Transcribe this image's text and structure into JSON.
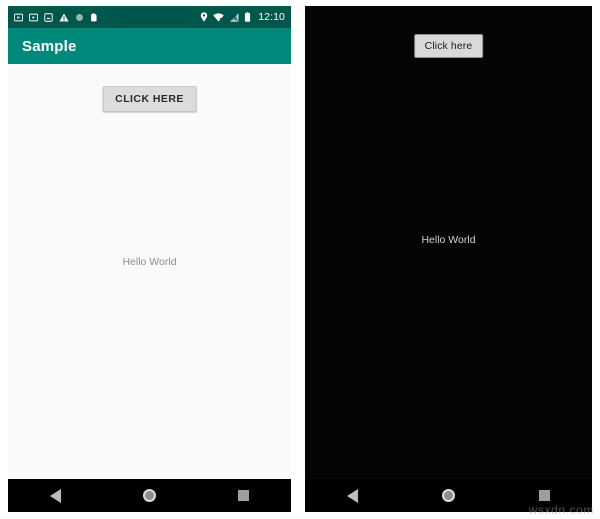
{
  "left_phone": {
    "theme_label": "light",
    "status_bar": {
      "background": "#00564a",
      "clock": "12:10",
      "left_icons": [
        {
          "name": "video-notification-icon",
          "glyph": "video"
        },
        {
          "name": "video-notification-icon-2",
          "glyph": "video"
        },
        {
          "name": "screenshot-notification-icon",
          "glyph": "image"
        },
        {
          "name": "warning-notification-icon",
          "glyph": "warning"
        },
        {
          "name": "circle-notification-icon",
          "glyph": "circle"
        },
        {
          "name": "usb-notification-icon",
          "glyph": "usb"
        }
      ],
      "right_icons": [
        {
          "name": "location-pin-icon",
          "glyph": "pin"
        },
        {
          "name": "wifi-icon",
          "glyph": "wifi"
        },
        {
          "name": "cell-signal-icon",
          "glyph": "signal"
        },
        {
          "name": "battery-icon",
          "glyph": "battery"
        }
      ]
    },
    "app_bar": {
      "title": "Sample",
      "background": "#00897b",
      "title_color": "#ffffff"
    },
    "content": {
      "background": "#fafafa",
      "button_label": "CLICK HERE",
      "body_text": "Hello World",
      "body_text_color": "#8d8d8d"
    }
  },
  "right_phone": {
    "theme_label": "dark",
    "content": {
      "background": "#050505",
      "button_label": "Click here",
      "body_text": "Hello World",
      "body_text_color": "#d2d2d2"
    }
  },
  "navigation_bar": {
    "background": "#000000",
    "buttons": [
      {
        "name": "back",
        "label": "Back"
      },
      {
        "name": "home",
        "label": "Home"
      },
      {
        "name": "recents",
        "label": "Recents"
      }
    ]
  },
  "watermark": {
    "text": "wsxdn.com"
  }
}
